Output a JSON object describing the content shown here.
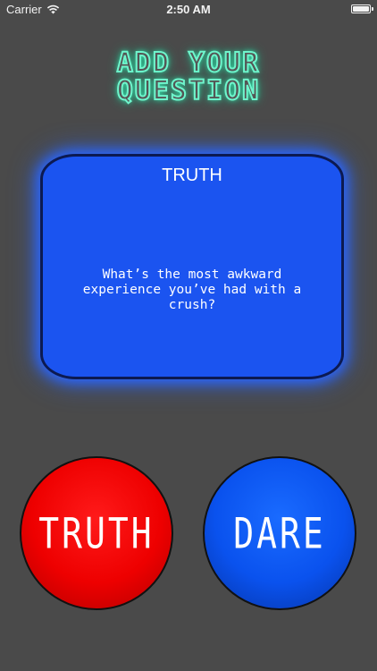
{
  "status_bar": {
    "carrier": "Carrier",
    "time": "2:50 AM"
  },
  "header": {
    "line1": "ADD YOUR",
    "line2": "QUESTION"
  },
  "card": {
    "label": "TRUTH",
    "question": "What’s the most awkward experience you’ve had with a crush?"
  },
  "buttons": {
    "truth_label": "TRUTH",
    "dare_label": "DARE"
  },
  "colors": {
    "background": "#4a4a4a",
    "neon": "#6ff5cc",
    "card": "#1b54f0",
    "truth": "#ee0000",
    "dare": "#0a52ee"
  },
  "icons": {
    "signal": "wifi-icon",
    "battery": "battery-icon"
  }
}
